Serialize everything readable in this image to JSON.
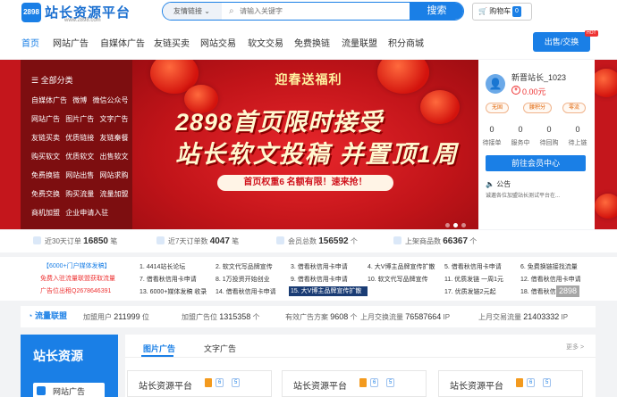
{
  "header": {
    "logo_badge": "2898",
    "logo_name": "站长资源平台",
    "logo_url": "www.2898.com",
    "search_category": "友情链接",
    "search_placeholder": "请输入关键字",
    "search_button": "搜索",
    "cart_label": "购物车",
    "cart_count": "0"
  },
  "nav": {
    "items": [
      "首页",
      "网站广告",
      "自媒体广告",
      "友链买卖",
      "网站交易",
      "软文交易",
      "免费换链",
      "流量联盟",
      "积分商城"
    ],
    "sell_button": "出售/交换",
    "hot_badge": "HOT"
  },
  "categories": {
    "title": "全部分类",
    "rows": [
      "自媒体广告 微博 微信公众号",
      "网站广告 图片广告 文字广告",
      "友链买卖 优质链接 友链秦餐",
      "购买软文 优质软文 出售软文",
      "免费换链 网站出售 网站求购",
      "免费交换 购买流量 流量加盟",
      "商机加盟 企业申请入驻"
    ]
  },
  "banner": {
    "subtitle": "迎春送福利",
    "headline1": "2898首页限时接受",
    "headline2": "站长软文投稿 并置顶1周",
    "pill": "首页权重6  名额有限！速来抢！"
  },
  "user": {
    "name": "新晋站长_1023",
    "balance": "0.00元",
    "tags": [
      "无固",
      "腰积分",
      "零流"
    ],
    "stats": [
      {
        "value": "0",
        "label": "待接单"
      },
      {
        "value": "0",
        "label": "服务中"
      },
      {
        "value": "0",
        "label": "待回购"
      },
      {
        "value": "0",
        "label": "待上链"
      }
    ],
    "center_button": "前往会员中心",
    "notice_title": "公告",
    "notice_text": "诚邀各位加盟站长测试平台在..."
  },
  "stats_bar": [
    {
      "prefix": "近30天订单",
      "value": "16850",
      "unit": "笔"
    },
    {
      "prefix": "近7天订单数",
      "value": "4047",
      "unit": "笔"
    },
    {
      "prefix": "会员总数",
      "value": "156592",
      "unit": "个"
    },
    {
      "prefix": "上架商品数",
      "value": "66367",
      "unit": "个"
    }
  ],
  "links": {
    "col1": [
      "【6000+门户媒体发稿】",
      "免费入驻流量联盟获取流量",
      "广告位出租Q2678646391"
    ],
    "grid": [
      [
        "1. 4414站长论坛",
        "2. 软文代写品牌宣传",
        "3. 借看秋信用卡申请",
        "4. 大V博主品牌宣传扩散",
        "5. 借看秋信用卡申请",
        "6. 免费换链接找流量"
      ],
      [
        "7. 借看秋信用卡申请",
        "8. 1万投资开始创业",
        "9. 借看秋信用卡申请",
        "10. 软文代写品牌宣传",
        "11. 优质发链 一周1元",
        "12. 借看秋信用卡申请"
      ],
      [
        "13. 6000+媒体发稿 收录",
        "14. 借看秋信用卡申请",
        "",
        "15. 大V博主品牌宣传扩散",
        "17. 优质发链2元起",
        "18. 借看秋信用卡申请"
      ]
    ],
    "watermark": "2898"
  },
  "union": {
    "title": "流量联盟",
    "items": [
      {
        "prefix": "加盟用户",
        "value": "211999",
        "unit": "位"
      },
      {
        "prefix": "加盟广告位",
        "value": "1315358",
        "unit": "个"
      },
      {
        "prefix": "有效广告方案",
        "value": "9608",
        "unit": "个"
      },
      {
        "prefix": "上月交换流量",
        "value": "76587664",
        "unit": "IP"
      },
      {
        "prefix": "上月交易流量",
        "value": "21403332",
        "unit": "IP"
      }
    ]
  },
  "bottom": {
    "left_title": "站长资源",
    "left_item": "网站广告",
    "tabs": [
      "图片广告",
      "文字广告"
    ],
    "more": "更多 >",
    "cards": [
      {
        "title": "站长资源平台",
        "b1": "6",
        "b2": "5"
      },
      {
        "title": "站长资源平台",
        "b1": "6",
        "b2": "5"
      },
      {
        "title": "站长资源平台",
        "b1": "6",
        "b2": "5"
      }
    ]
  },
  "colors": {
    "brand": "#1a7fe6",
    "banner_red": "#c4161c",
    "accent_red": "#e33"
  }
}
